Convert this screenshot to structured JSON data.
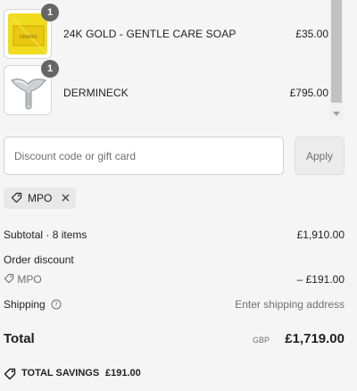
{
  "products": [
    {
      "name": "24K GOLD - GENTLE CARE SOAP",
      "price": "£35.00",
      "quantity": "1",
      "image_text": "ORAFAX"
    },
    {
      "name": "DERMINECK",
      "price": "£795.00",
      "quantity": "1"
    }
  ],
  "discount": {
    "placeholder": "Discount code or gift card",
    "apply_label": "Apply",
    "applied_code": "MPO"
  },
  "summary": {
    "subtotal_label": "Subtotal · 8 items",
    "subtotal_value": "£1,910.00",
    "order_discount_label": "Order discount",
    "discount_code": "MPO",
    "discount_value": "– £191.00",
    "shipping_label": "Shipping",
    "shipping_value": "Enter shipping address",
    "total_label": "Total",
    "currency": "GBP",
    "total_value": "£1,719.00",
    "savings_label": "TOTAL SAVINGS",
    "savings_value": "£191.00"
  },
  "colors": {
    "background": "#f5f5f5",
    "badge": "#666666",
    "muted_text": "#707070",
    "chip_bg": "#e8e8e8"
  }
}
